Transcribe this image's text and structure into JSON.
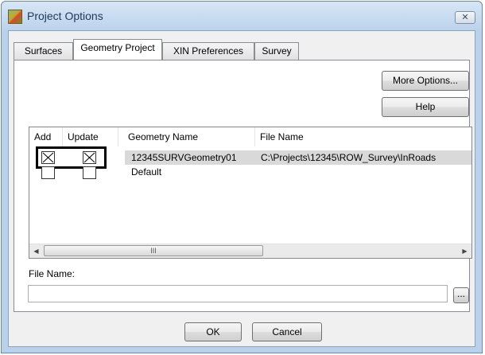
{
  "window": {
    "title": "Project Options",
    "close_glyph": "✕"
  },
  "tabs": [
    {
      "label": "Surfaces",
      "active": false
    },
    {
      "label": "Geometry Project",
      "active": true
    },
    {
      "label": "XIN Preferences",
      "active": false
    },
    {
      "label": "Survey",
      "active": false
    }
  ],
  "buttons": {
    "more_options": "More Options...",
    "help": "Help",
    "ok": "OK",
    "cancel": "Cancel",
    "browse": "..."
  },
  "grid": {
    "columns": [
      "Add",
      "Update",
      "Geometry Name",
      "File Name"
    ],
    "rows": [
      {
        "add": true,
        "update": true,
        "geometry_name": "12345SURVGeometry01",
        "file_name": "C:\\Projects\\12345\\ROW_Survey\\InRoads",
        "selected": true
      },
      {
        "add": false,
        "update": false,
        "geometry_name": "Default",
        "file_name": "",
        "selected": false
      }
    ],
    "scroll_left": "◀",
    "scroll_right": "▶",
    "thumb_grip": "III"
  },
  "file_name": {
    "label": "File Name:",
    "value": ""
  },
  "colors": {
    "title_bar": "#bcd3ec",
    "selection": "#d9d9d9",
    "highlight_border": "#000000"
  }
}
